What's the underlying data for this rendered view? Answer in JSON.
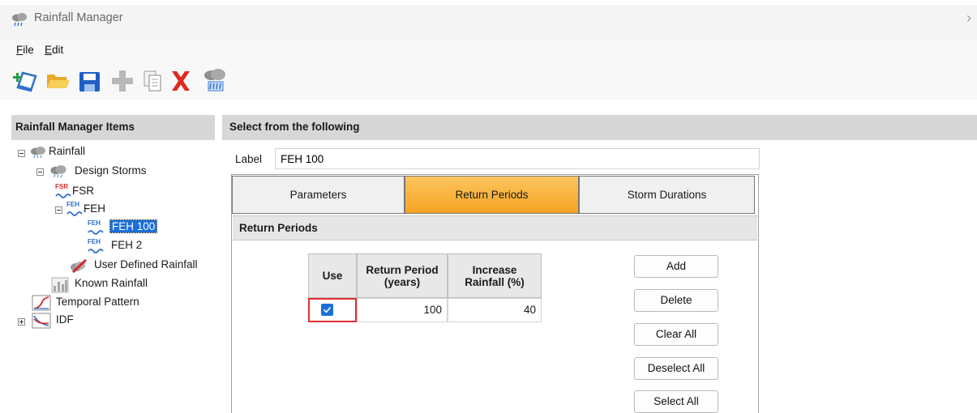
{
  "window": {
    "title": "Rainfall Manager",
    "close_glyph": "›"
  },
  "menu": {
    "file_underline": "F",
    "file_rest": "ile",
    "edit_underline": "E",
    "edit_rest": "dit"
  },
  "toolbar": {
    "icons": [
      "new-icon",
      "open-folder-icon",
      "save-icon",
      "add-icon",
      "copy-icon",
      "delete-icon",
      "rainfall-icon"
    ]
  },
  "left_panel": {
    "header": "Rainfall Manager Items",
    "tree": {
      "rainfall": "Rainfall",
      "design_storms": "Design Storms",
      "fsr": "FSR",
      "feh": "FEH",
      "feh_100": "FEH 100",
      "feh_2": "FEH 2",
      "user_defined": "User Defined Rainfall",
      "known_rainfall": "Known Rainfall",
      "temporal_pattern": "Temporal Pattern",
      "idf": "IDF"
    },
    "icon_text": {
      "fsr": "FSR",
      "feh": "FEH"
    }
  },
  "right_panel": {
    "header": "Select from the following",
    "label_caption": "Label",
    "label_value": "FEH 100",
    "tabs": {
      "parameters": "Parameters",
      "return_periods": "Return Periods",
      "storm_durations": "Storm Durations"
    },
    "active_tab": "return_periods",
    "section_title": "Return Periods",
    "grid": {
      "columns": {
        "use": "Use",
        "return_period_line1": "Return Period",
        "return_period_line2": "(years)",
        "increase_line1": "Increase",
        "increase_line2": "Rainfall (%)"
      },
      "rows": [
        {
          "use": true,
          "return_period": "100",
          "increase_rainfall": "40"
        }
      ]
    },
    "buttons": {
      "add": "Add",
      "delete": "Delete",
      "clear_all": "Clear All",
      "deselect_all": "Deselect All",
      "select_all": "Select All"
    }
  },
  "colors": {
    "active_tab": "#f9b23a",
    "selection": "#1a6fd8",
    "highlight_border": "#e03030"
  }
}
